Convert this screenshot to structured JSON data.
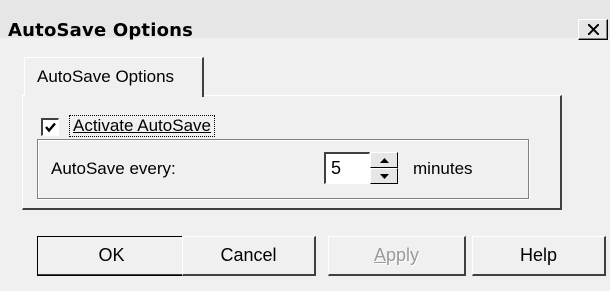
{
  "window": {
    "title": "AutoSave Options",
    "close_glyph": "close-icon"
  },
  "tab": {
    "label": "AutoSave Options"
  },
  "autosave": {
    "checkbox_label": "Activate AutoSave",
    "checked": true,
    "interval_label": "AutoSave every:",
    "interval_value": "5",
    "interval_unit": "minutes"
  },
  "buttons": {
    "ok": "OK",
    "cancel": "Cancel",
    "apply_accel": "A",
    "apply_rest": "pply",
    "help": "Help"
  }
}
